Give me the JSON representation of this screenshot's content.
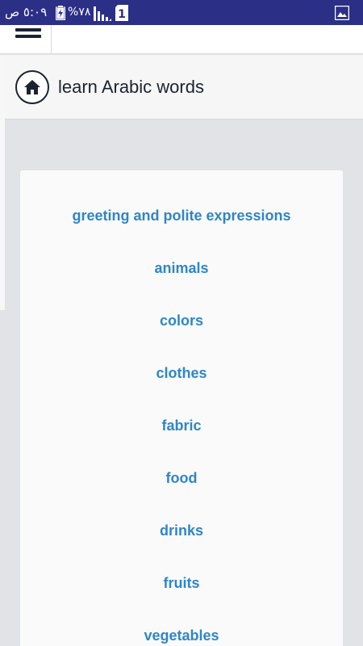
{
  "status_bar": {
    "time": "٥:٠٩ ص",
    "battery_percent": "%٧٨",
    "sim_slot": "1",
    "icons": [
      "battery-charging-icon",
      "signal-icon",
      "sim-icon",
      "gallery-icon"
    ],
    "background_color": "#2b2f86"
  },
  "header": {
    "title": "learn Arabic words",
    "home_icon": "home-icon"
  },
  "menu": {
    "icon": "hamburger-menu-icon"
  },
  "topics": [
    {
      "label": "greeting and polite expressions"
    },
    {
      "label": "animals"
    },
    {
      "label": "colors"
    },
    {
      "label": "clothes"
    },
    {
      "label": "fabric"
    },
    {
      "label": "food"
    },
    {
      "label": "drinks"
    },
    {
      "label": "fruits"
    },
    {
      "label": "vegetables"
    }
  ],
  "colors": {
    "link": "#2f86c6",
    "background": "#e1e3e6",
    "card": "#fafafa",
    "text_dark": "#1c2230"
  }
}
